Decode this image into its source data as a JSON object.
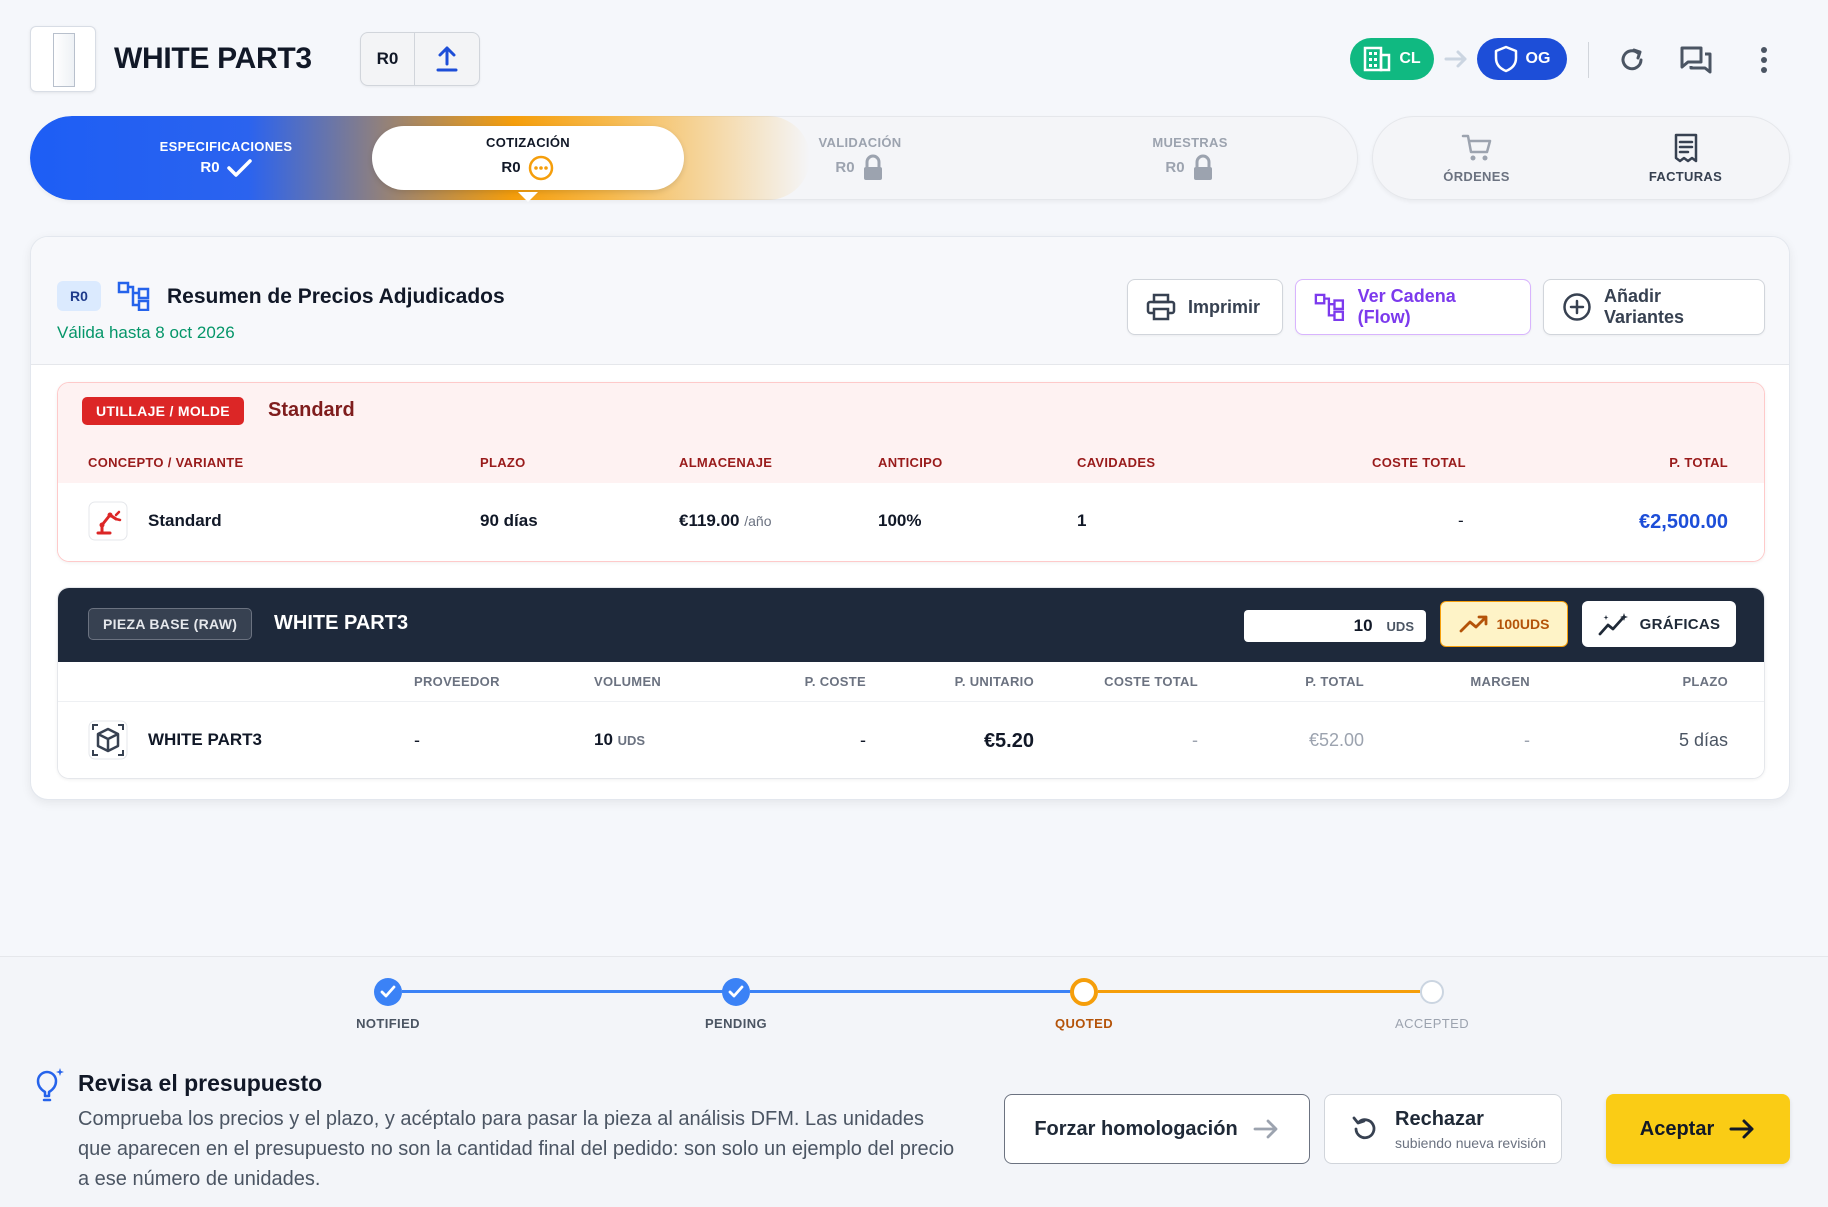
{
  "header": {
    "title": "WHITE PART3",
    "revision": "R0",
    "badge_client": "CL",
    "badge_owner": "OG"
  },
  "steps": [
    {
      "label": "ESPECIFICACIONES",
      "rev": "R0",
      "state": "done"
    },
    {
      "label": "COTIZACIÓN",
      "rev": "R0",
      "state": "current"
    },
    {
      "label": "VALIDACIÓN",
      "rev": "R0",
      "state": "locked"
    },
    {
      "label": "MUESTRAS",
      "rev": "R0",
      "state": "locked"
    }
  ],
  "side_tabs": [
    {
      "label": "ÓRDENES",
      "icon": "cart-icon"
    },
    {
      "label": "FACTURAS",
      "icon": "receipt-icon"
    }
  ],
  "summary": {
    "rev_badge": "R0",
    "title": "Resumen de Precios Adjudicados",
    "valid_until": "Válida hasta 8 oct 2026",
    "buttons": {
      "print": "Imprimir",
      "flow": "Ver Cadena (Flow)",
      "add_variants": "Añadir Variantes"
    }
  },
  "tooling": {
    "tag": "UTILLAJE / MOLDE",
    "name": "Standard",
    "columns": [
      "CONCEPTO / VARIANTE",
      "PLAZO",
      "ALMACENAJE",
      "ANTICIPO",
      "CAVIDADES",
      "COSTE TOTAL",
      "P. TOTAL"
    ],
    "row": {
      "concept": "Standard",
      "lead_time": "90 días",
      "storage": "€119.00",
      "storage_unit": "/año",
      "advance": "100%",
      "cavities": "1",
      "total_cost": "-",
      "total_price": "€2,500.00"
    }
  },
  "raw_part": {
    "tag": "PIEZA BASE (RAW)",
    "name": "WHITE PART3",
    "qty_value": "10",
    "qty_unit": "UDS",
    "btn_100": "100UDS",
    "btn_charts": "GRÁFICAS",
    "columns": [
      "PROVEEDOR",
      "VOLUMEN",
      "P. COSTE",
      "P. UNITARIO",
      "COSTE TOTAL",
      "P. TOTAL",
      "MARGEN",
      "PLAZO"
    ],
    "row": {
      "name": "WHITE PART3",
      "supplier": "-",
      "volume": "10",
      "volume_unit": "UDS",
      "cost_price": "-",
      "unit_price": "€5.20",
      "total_cost": "-",
      "total_price": "€52.00",
      "margin": "-",
      "lead_time": "5 días"
    }
  },
  "progress": [
    {
      "label": "NOTIFIED",
      "state": "done"
    },
    {
      "label": "PENDING",
      "state": "done"
    },
    {
      "label": "QUOTED",
      "state": "current"
    },
    {
      "label": "ACCEPTED",
      "state": "todo"
    }
  ],
  "tip": {
    "title": "Revisa el presupuesto",
    "body": "Comprueba los precios y el plazo, y acéptalo para pasar la pieza al análisis DFM. Las unidades que aparecen en el presupuesto no son la cantidad final del pedido: son solo un ejemplo del precio a ese número de unidades."
  },
  "actions": {
    "force": "Forzar homologación",
    "reject": "Rechazar",
    "reject_sub": "subiendo nueva revisión",
    "accept": "Aceptar"
  },
  "colors": {
    "primary": "#1d5ef5",
    "quote": "#f59e0b",
    "success": "#10b981",
    "danger": "#dc2626",
    "accept": "#facc15"
  }
}
